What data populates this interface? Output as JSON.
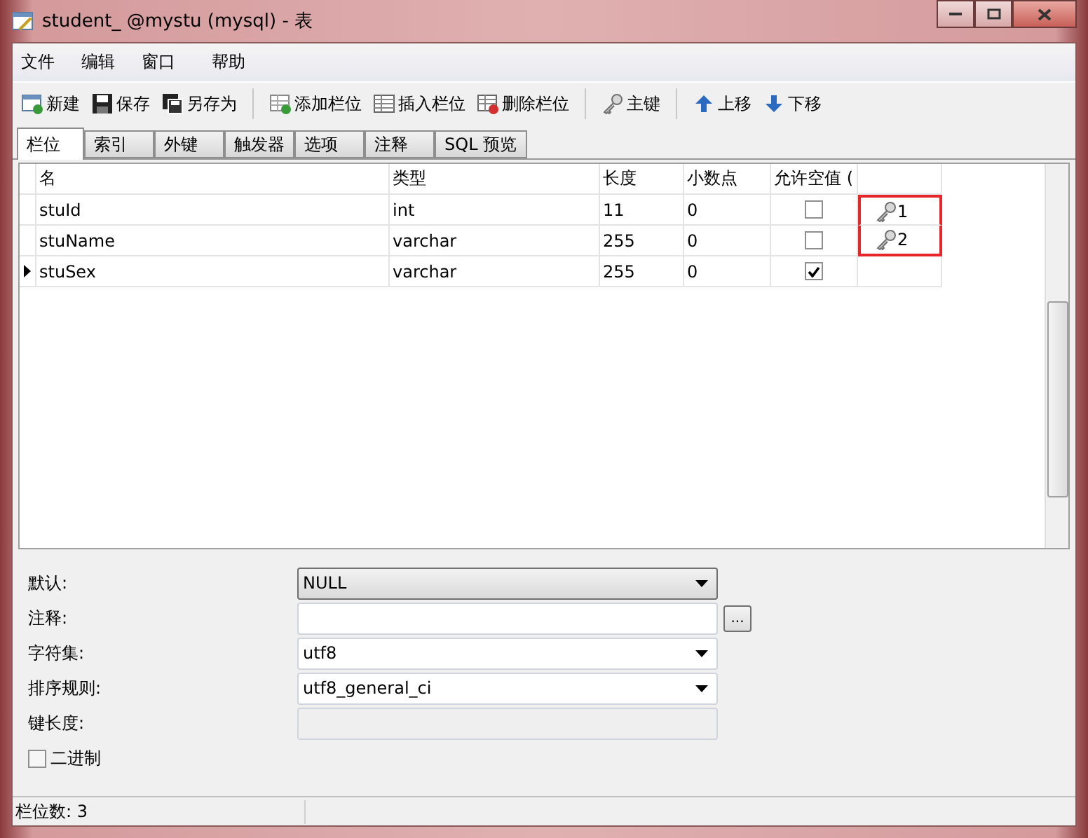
{
  "window": {
    "title": "student_ @mystu (mysql) - 表"
  },
  "menu": [
    "文件",
    "编辑",
    "窗口",
    "帮助"
  ],
  "toolbar": [
    {
      "kind": "new",
      "label": "新建"
    },
    {
      "kind": "save",
      "label": "保存"
    },
    {
      "kind": "saveas",
      "label": "另存为"
    },
    {
      "kind": "sep"
    },
    {
      "kind": "addcol",
      "label": "添加栏位"
    },
    {
      "kind": "inscol",
      "label": "插入栏位"
    },
    {
      "kind": "delcol",
      "label": "删除栏位"
    },
    {
      "kind": "sep"
    },
    {
      "kind": "key",
      "label": "主键"
    },
    {
      "kind": "sep"
    },
    {
      "kind": "up",
      "label": "上移"
    },
    {
      "kind": "down",
      "label": "下移"
    }
  ],
  "tabs": [
    {
      "label": "栏位",
      "selected": true
    },
    {
      "label": "索引",
      "selected": false
    },
    {
      "label": "外键",
      "selected": false
    },
    {
      "label": "触发器",
      "selected": false
    },
    {
      "label": "选项",
      "selected": false
    },
    {
      "label": "注释",
      "selected": false
    },
    {
      "label": "SQL 预览",
      "selected": false
    }
  ],
  "table": {
    "columns": [
      "名",
      "类型",
      "长度",
      "小数点",
      "允许空值 ("
    ],
    "rows": [
      {
        "name": "stuId",
        "type": "int",
        "length": "11",
        "decimals": "0",
        "nullable": false,
        "key": "1",
        "highlighted": true,
        "selected": false
      },
      {
        "name": "stuName",
        "type": "varchar",
        "length": "255",
        "decimals": "0",
        "nullable": false,
        "key": "2",
        "highlighted": true,
        "selected": false
      },
      {
        "name": "stuSex",
        "type": "varchar",
        "length": "255",
        "decimals": "0",
        "nullable": true,
        "highlighted": false,
        "selected": true
      }
    ]
  },
  "properties": [
    {
      "kind": "select",
      "label": "默认:",
      "value": "NULL",
      "raised": true
    },
    {
      "kind": "text",
      "label": "注释:",
      "button": "..."
    },
    {
      "kind": "select",
      "label": "字符集:",
      "value": "utf8"
    },
    {
      "kind": "select",
      "label": "排序规则:",
      "value": "utf8_general_ci"
    },
    {
      "kind": "disabled",
      "label": "键长度:"
    },
    {
      "kind": "checkbox",
      "label": "二进制",
      "checked": false
    }
  ],
  "status_bar": "栏位数: 3"
}
